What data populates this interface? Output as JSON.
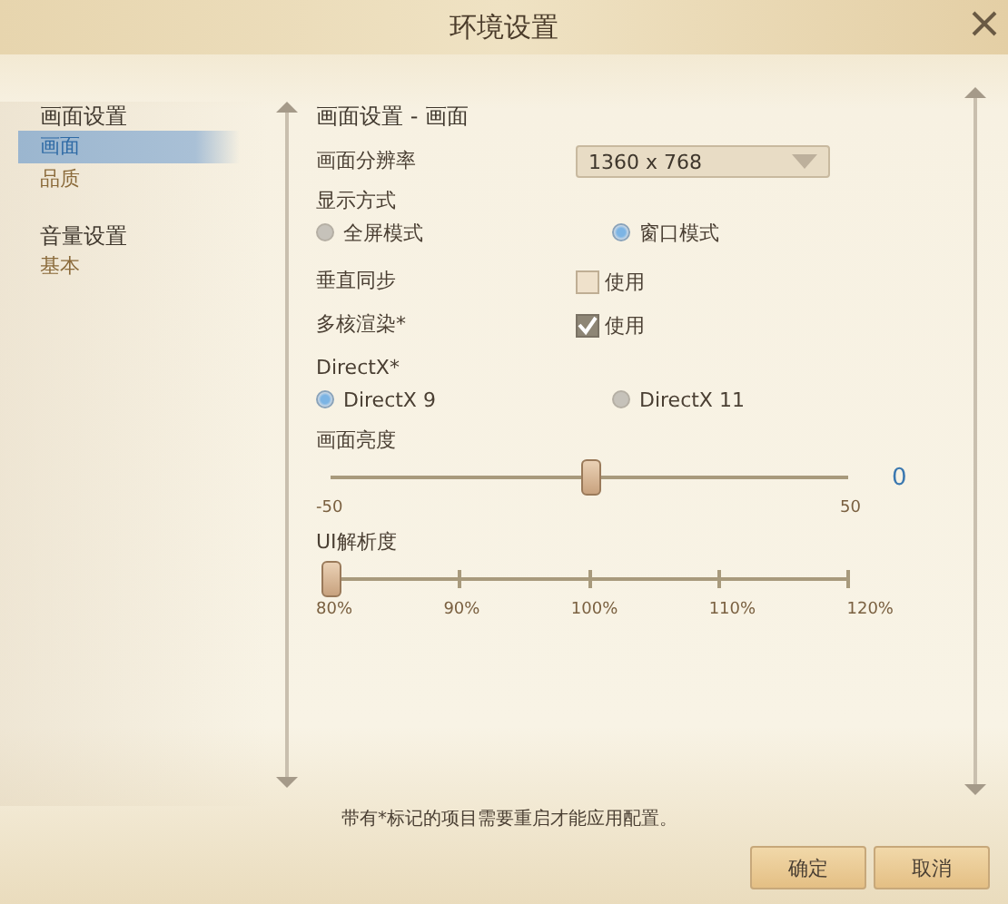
{
  "window": {
    "title": "环境设置"
  },
  "sidebar": {
    "groups": [
      {
        "title": "画面设置",
        "items": [
          {
            "label": "画面",
            "selected": true
          },
          {
            "label": "品质",
            "selected": false
          }
        ]
      },
      {
        "title": "音量设置",
        "items": [
          {
            "label": "基本",
            "selected": false
          }
        ]
      }
    ]
  },
  "panel": {
    "title": "画面设置 - 画面",
    "resolution": {
      "label": "画面分辨率",
      "value": "1360 x 768"
    },
    "display_mode": {
      "label": "显示方式",
      "options": [
        {
          "label": "全屏模式",
          "selected": false
        },
        {
          "label": "窗口模式",
          "selected": true
        }
      ]
    },
    "toggles": [
      {
        "label": "垂直同步",
        "option": "使用",
        "checked": false
      },
      {
        "label": "多核渲染*",
        "option": "使用",
        "checked": true
      }
    ],
    "directx": {
      "label": "DirectX*",
      "options": [
        {
          "label": "DirectX 9",
          "selected": true
        },
        {
          "label": "DirectX 11",
          "selected": false
        }
      ]
    },
    "sliders": [
      {
        "label": "画面亮度",
        "level": 0.5,
        "reading": "0",
        "ticks": [
          "-50",
          "50"
        ]
      },
      {
        "label": "UI解析度",
        "level": 0,
        "ticks": [
          "80%",
          "90%",
          "100%",
          "110%",
          "120%"
        ]
      }
    ]
  },
  "footer": {
    "note": "带有*标记的项目需要重启才能应用配置。",
    "buttons": [
      "确定",
      "取消"
    ]
  }
}
